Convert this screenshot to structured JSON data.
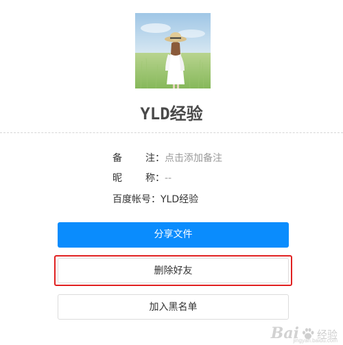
{
  "profile": {
    "name": "YLD经验"
  },
  "info": {
    "remark_label_1": "备",
    "remark_label_2": "注：",
    "remark_value": "点击添加备注",
    "nickname_label_1": "昵",
    "nickname_label_2": "称：",
    "nickname_value": "--",
    "account_label": "百度帐号：",
    "account_value": "YLD经验"
  },
  "actions": {
    "share_label": "分享文件",
    "delete_label": "删除好友",
    "block_label": "加入黑名单"
  },
  "watermark": {
    "brand": "Bai",
    "text": "经验",
    "sub": "jingyan.baidu.com"
  },
  "colors": {
    "primary": "#0a8cfd",
    "highlight": "#e02020"
  }
}
